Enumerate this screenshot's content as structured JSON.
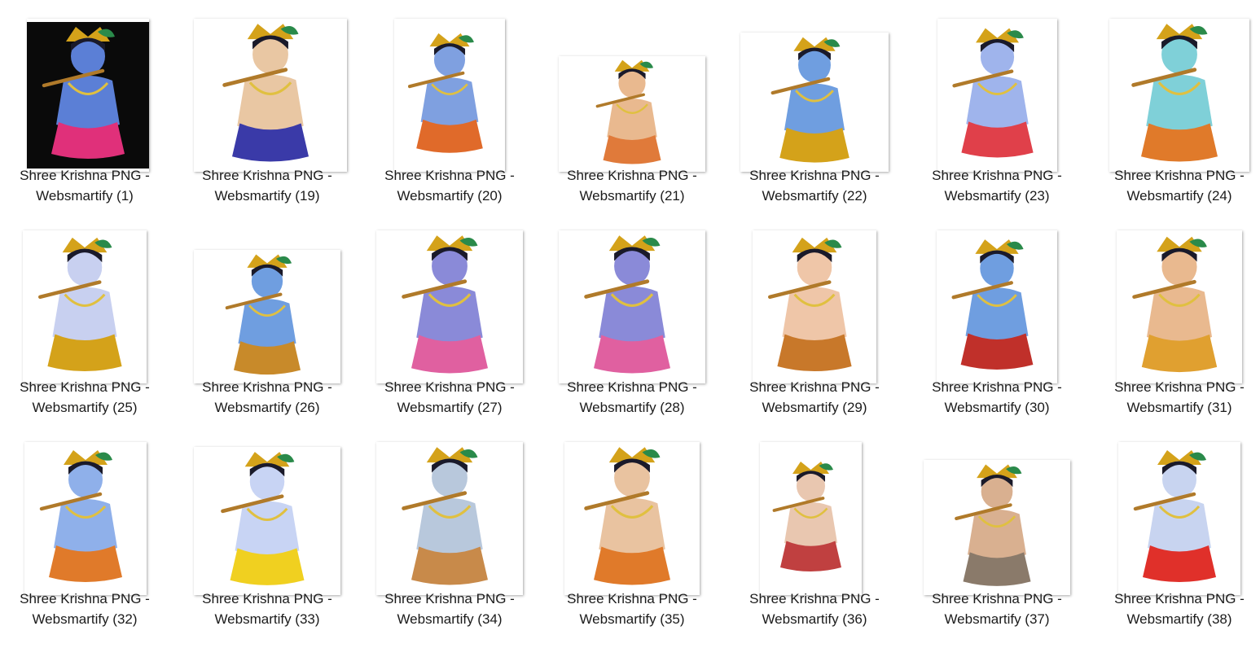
{
  "files": [
    {
      "line1": "Shree Krishna PNG -",
      "line2": "Websmartify (1)",
      "thumb": "dark",
      "skin": "#5b7fd6",
      "accent": "#e0307a"
    },
    {
      "line1": "Shree Krishna PNG -",
      "line2": "Websmartify (19)",
      "thumb": "light",
      "skin": "#e9c7a3",
      "accent": "#3a3aa8"
    },
    {
      "line1": "Shree Krishna PNG -",
      "line2": "Websmartify (20)",
      "thumb": "light",
      "skin": "#7fa0e0",
      "accent": "#e06a2a"
    },
    {
      "line1": "Shree Krishna PNG -",
      "line2": "Websmartify (21)",
      "thumb": "light",
      "skin": "#e9b98f",
      "accent": "#e07a3a"
    },
    {
      "line1": "Shree Krishna PNG -",
      "line2": "Websmartify (22)",
      "thumb": "light",
      "skin": "#6f9ee0",
      "accent": "#d4a21a"
    },
    {
      "line1": "Shree Krishna PNG -",
      "line2": "Websmartify (23)",
      "thumb": "light",
      "skin": "#9fb4ec",
      "accent": "#e0404a"
    },
    {
      "line1": "Shree Krishna PNG -",
      "line2": "Websmartify (24)",
      "thumb": "light",
      "skin": "#7fd0d8",
      "accent": "#e07a2a"
    },
    {
      "line1": "Shree Krishna PNG -",
      "line2": "Websmartify (25)",
      "thumb": "light",
      "skin": "#c8d0f0",
      "accent": "#d4a21a"
    },
    {
      "line1": "Shree Krishna PNG -",
      "line2": "Websmartify (26)",
      "thumb": "light",
      "skin": "#6f9ee0",
      "accent": "#c88a2a"
    },
    {
      "line1": "Shree Krishna PNG -",
      "line2": "Websmartify (27)",
      "thumb": "light",
      "skin": "#8a8ad8",
      "accent": "#e060a0"
    },
    {
      "line1": "Shree Krishna PNG -",
      "line2": "Websmartify (28)",
      "thumb": "light",
      "skin": "#8a8ad8",
      "accent": "#e060a0"
    },
    {
      "line1": "Shree Krishna PNG -",
      "line2": "Websmartify (29)",
      "thumb": "light",
      "skin": "#efc6a8",
      "accent": "#c8782a"
    },
    {
      "line1": "Shree Krishna PNG -",
      "line2": "Websmartify (30)",
      "thumb": "light",
      "skin": "#6f9ee0",
      "accent": "#c0302a"
    },
    {
      "line1": "Shree Krishna PNG -",
      "line2": "Websmartify (31)",
      "thumb": "light",
      "skin": "#e9b98f",
      "accent": "#e0a030"
    },
    {
      "line1": "Shree Krishna PNG -",
      "line2": "Websmartify (32)",
      "thumb": "light",
      "skin": "#8fb0ea",
      "accent": "#e07a2a"
    },
    {
      "line1": "Shree Krishna PNG -",
      "line2": "Websmartify (33)",
      "thumb": "light",
      "skin": "#c8d4f4",
      "accent": "#f0d020"
    },
    {
      "line1": "Shree Krishna PNG -",
      "line2": "Websmartify (34)",
      "thumb": "light",
      "skin": "#b8c8dc",
      "accent": "#c88a4a"
    },
    {
      "line1": "Shree Krishna PNG -",
      "line2": "Websmartify (35)",
      "thumb": "light",
      "skin": "#e9c3a0",
      "accent": "#e07a2a"
    },
    {
      "line1": "Shree Krishna PNG -",
      "line2": "Websmartify (36)",
      "thumb": "light",
      "skin": "#e9c7b0",
      "accent": "#c04040"
    },
    {
      "line1": "Shree Krishna PNG -",
      "line2": "Websmartify (37)",
      "thumb": "light",
      "skin": "#d9b090",
      "accent": "#8a7a6a"
    },
    {
      "line1": "Shree Krishna PNG -",
      "line2": "Websmartify (38)",
      "thumb": "light",
      "skin": "#c8d4f0",
      "accent": "#e0302a"
    }
  ]
}
